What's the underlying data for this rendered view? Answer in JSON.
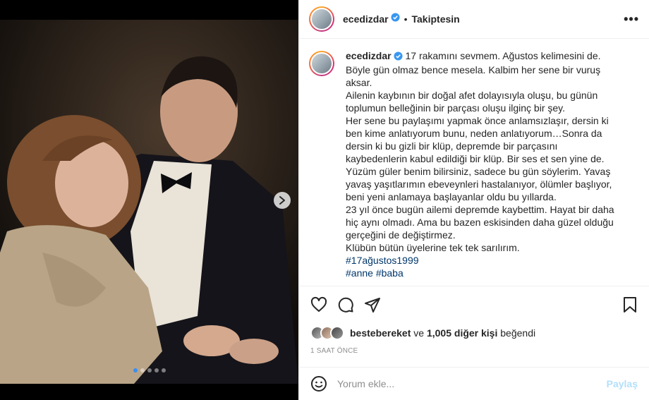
{
  "post": {
    "username": "ecedizdar",
    "separator": "•",
    "follow_status": "Takiptesin",
    "more_label": "•••"
  },
  "caption": {
    "username": "ecedizdar",
    "lines": [
      "17 rakamını sevmem. Ağustos kelimesini de.",
      "Böyle gün olmaz bence mesela. Kalbim her sene bir vuruş",
      "aksar.",
      "Ailenin kaybının bir doğal afet dolayısıyla oluşu, bu günün",
      "toplumun belleğinin bir parçası oluşu ilginç bir şey.",
      "Her sene bu paylaşımı yapmak önce anlamsızlaşır, dersin ki",
      "ben kime anlatıyorum bunu, neden anlatıyorum…Sonra da",
      "dersin ki bu gizli bir klüp, depremde bir parçasını",
      "kaybedenlerin kabul edildiği bir klüp. Bir ses et sen yine de.",
      "Yüzüm güler benim bilirsiniz, sadece bu gün söylerim. Yavaş",
      "yavaş yaşıtlarımın ebeveynleri hastalanıyor, ölümler başlıyor,",
      "beni yeni anlamaya başlayanlar oldu bu yıllarda.",
      "23 yıl önce bugün ailemi depremde kaybettim. Hayat bir daha",
      "hiç aynı olmadı. Ama bu bazen eskisinden daha güzel olduğu",
      "gerçeğini de değiştirmez.",
      "Klübün bütün üyelerine tek tek sarılırım."
    ],
    "hashtags": [
      "#17ağustos1999",
      "#anne #baba"
    ]
  },
  "likes": {
    "first_user": "bestebereket",
    "connector": "ve",
    "others": "1,005 diğer kişi",
    "suffix": "beğendi"
  },
  "timestamp": "1 SAAT ÖNCE",
  "comment": {
    "placeholder": "Yorum ekle...",
    "post_label": "Paylaş"
  },
  "carousel": {
    "slide_count": 5,
    "active_index": 0
  },
  "colors": {
    "verified": "#3897f0",
    "hashtag": "#00376b",
    "post_button": "#b2dffc",
    "active_dot": "#3b8ef0"
  }
}
